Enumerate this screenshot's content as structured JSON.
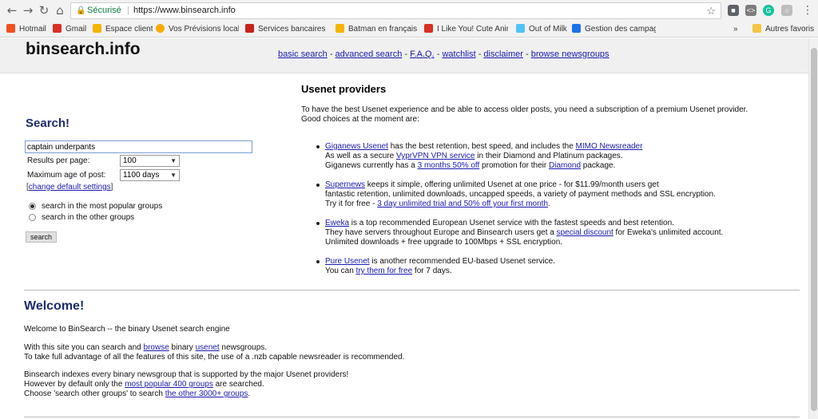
{
  "browser": {
    "secure_label": "Sécurisé",
    "url": "https://www.binsearch.info",
    "bookmarks": [
      {
        "label": "Hotmail",
        "color": "#f25022"
      },
      {
        "label": "Gmail",
        "color": "#d93025"
      },
      {
        "label": "Espace client",
        "color": "#f4b400"
      },
      {
        "label": "Vos Prévisions locales",
        "color": "#f9ab00"
      },
      {
        "label": "Services bancaires pe",
        "color": "#c5221f"
      },
      {
        "label": "Batman en français o",
        "color": "#f4b400"
      },
      {
        "label": "I Like You! Cute Anim",
        "color": "#d93025"
      },
      {
        "label": "Out of Milk",
        "color": "#4fc3f7"
      },
      {
        "label": "Gestion des campagn",
        "color": "#1a73e8"
      },
      {
        "label": "Autres favoris",
        "color": "#f4c542"
      }
    ],
    "more_label": "»"
  },
  "site": {
    "logo": "binsearch.info",
    "nav": [
      "basic search",
      "advanced search",
      "F.A.Q.",
      "watchlist",
      "disclaimer",
      "browse newsgroups"
    ],
    "nav_sep": " - "
  },
  "search": {
    "title": "Search!",
    "query": "captain underpants",
    "results_label": "Results per page:",
    "results_value": "100",
    "max_age_label": "Maximum age of post:",
    "max_age_value": "1100 days",
    "change_link": "change default settings",
    "bracket_open": "[",
    "bracket_close": "]",
    "radio_popular": "search in the most popular groups",
    "radio_other": "search in the other groups",
    "button": "search"
  },
  "providers": {
    "title": "Usenet providers",
    "intro_1": "To have the best Usenet experience and be able to access older posts, you need a subscription of a premium Usenet provider.",
    "intro_2": "Good choices at the moment are:",
    "giganews": {
      "name": "Giganews Usenet",
      "t1": " has the best retention, best speed, and includes the ",
      "mimo": "MIMO Newsreader",
      "t2": "As well as a secure ",
      "vypr": "VyprVPN VPN service",
      "t3": " in their Diamond and Platinum packages.",
      "t4": "Giganews currently has a ",
      "promo": "3 months 50% off",
      "t5": " promotion for their ",
      "diamond": "Diamond",
      "t6": " package."
    },
    "supernews": {
      "name": "Supernews",
      "t1": " keeps it simple, offering unlimited Usenet at one price - for $11.99/month users get",
      "t2": "fantastic retention, unlimited downloads, uncapped speeds, a variety of payment methods and SSL encryption.",
      "t3": "Try it for free - ",
      "trial": "3 day unlimited trial and 50% off your first month",
      "t4": "."
    },
    "eweka": {
      "name": "Eweka",
      "t1": " is a top recommended European Usenet service with the fastest speeds and best retention.",
      "t2": "They have servers throughout Europe and Binsearch users get a ",
      "discount": "special discount",
      "t3": " for Eweka's unlimited account.",
      "t4": "Unlimited downloads + free upgrade to 100Mbps + SSL encryption."
    },
    "pure": {
      "name": "Pure Usenet",
      "t1": " is another recommended EU-based Usenet service.",
      "t2": "You can ",
      "try": "try them for free",
      "t3": " for 7 days."
    }
  },
  "welcome": {
    "title": "Welcome!",
    "line1": "Welcome to BinSearch -- the binary Usenet search engine",
    "l2a": "With this site you can search and ",
    "browse": "browse",
    "l2b": " binary ",
    "usenet": "usenet",
    "l2c": " newsgroups.",
    "line3": "To take full advantage of all the features of this site, the use of a .nzb capable newsreader is recommended.",
    "line4": "Binsearch indexes every binary newsgroup that is supported by the major Usenet providers!",
    "l5a": "However by default only the ",
    "popular": "most popular 400 groups",
    "l5b": " are searched.",
    "l6a": "Choose 'search other groups' to search ",
    "other": "the other 3000+ groups",
    "l6b": "."
  }
}
